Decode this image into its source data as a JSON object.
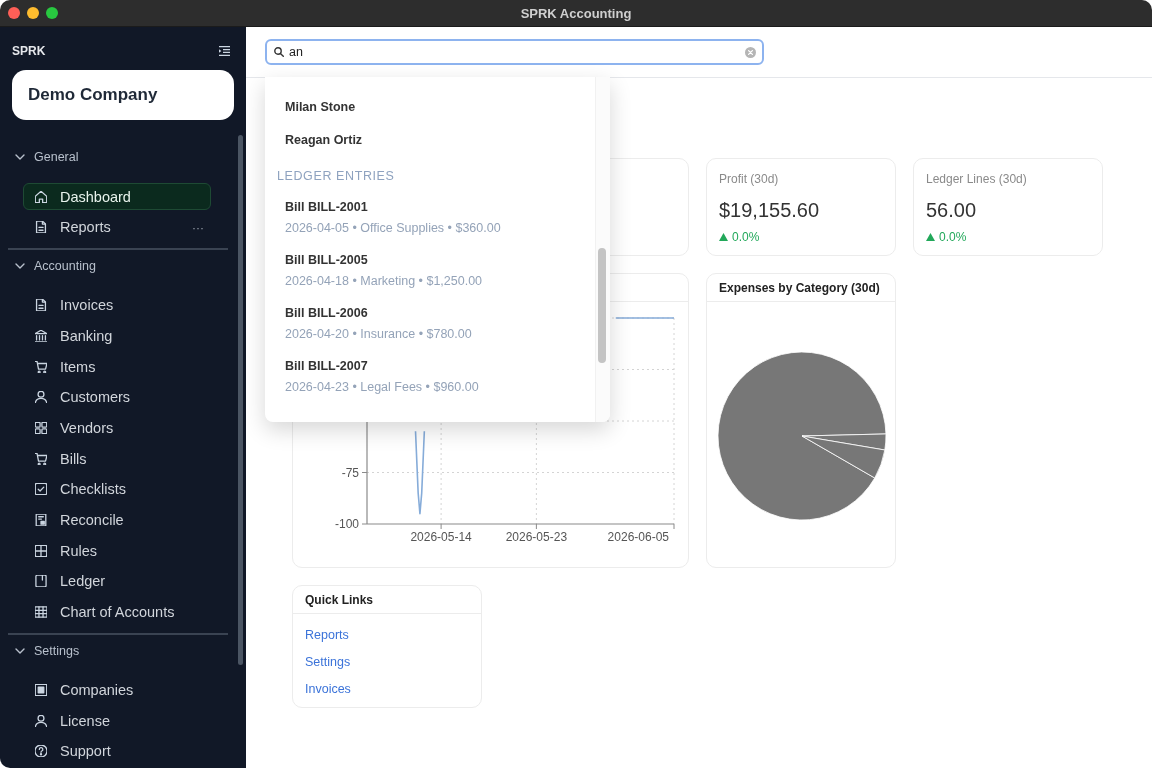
{
  "window": {
    "title": "SPRK Accounting"
  },
  "sidebar": {
    "brand": "SPRK",
    "company": "Demo Company",
    "groups": [
      {
        "title": "General",
        "expanded": true,
        "items": [
          {
            "label": "Dashboard",
            "selected": true
          },
          {
            "label": "Reports",
            "selected": false,
            "more": "···"
          }
        ]
      },
      {
        "title": "Accounting",
        "expanded": true,
        "items": [
          {
            "label": "Invoices",
            "selected": false
          },
          {
            "label": "Banking",
            "selected": false
          },
          {
            "label": "Items",
            "selected": false
          },
          {
            "label": "Customers",
            "selected": false
          },
          {
            "label": "Vendors",
            "selected": false
          },
          {
            "label": "Bills",
            "selected": false
          },
          {
            "label": "Checklists",
            "selected": false
          },
          {
            "label": "Reconcile",
            "selected": false
          },
          {
            "label": "Rules",
            "selected": false
          },
          {
            "label": "Ledger",
            "selected": false
          },
          {
            "label": "Chart of Accounts",
            "selected": false
          }
        ]
      },
      {
        "title": "Settings",
        "expanded": true,
        "items": [
          {
            "label": "Companies",
            "selected": false
          },
          {
            "label": "License",
            "selected": false
          },
          {
            "label": "Support",
            "selected": false
          }
        ]
      }
    ]
  },
  "search": {
    "value": "an",
    "results": [
      {
        "kind": "item",
        "title": "Milan Stone"
      },
      {
        "kind": "item",
        "title": "Reagan Ortiz"
      },
      {
        "kind": "heading",
        "title": "LEDGER ENTRIES"
      },
      {
        "kind": "entry",
        "title": "Bill BILL-2001",
        "detail": "2026-04-05 • Office Supplies • $360.00"
      },
      {
        "kind": "entry",
        "title": "Bill BILL-2005",
        "detail": "2026-04-18 • Marketing • $1,250.00"
      },
      {
        "kind": "entry",
        "title": "Bill BILL-2006",
        "detail": "2026-04-20 • Insurance • $780.00"
      },
      {
        "kind": "entry",
        "title": "Bill BILL-2007",
        "detail": "2026-04-23 • Legal Fees • $960.00"
      }
    ]
  },
  "stats": [
    {
      "label": "Profit (30d)",
      "value": "$19,155.60",
      "trend_up": true,
      "change": "0.0%"
    },
    {
      "label": "Ledger Lines (30d)",
      "value": "56.00",
      "trend_up": true,
      "change": "0.0%"
    }
  ],
  "line_chart": {
    "chart_data": {
      "type": "line",
      "x": [
        "2026-05-11T14:00",
        "2026-05-11T20:00",
        "2026-05-12",
        "2026-05-12T04:00",
        "2026-05-12T10:00",
        "2026-05-21",
        "2026-05-30T12:00",
        "2026-06-05"
      ],
      "series": [
        {
          "color": "#86acd9",
          "values": [
            -55,
            -85,
            -95,
            -85,
            -55,
            null,
            0,
            0
          ]
        }
      ],
      "xlim": [
        "2026-05-07",
        "2026-06-05"
      ],
      "ylim": [
        -100,
        0
      ],
      "xticks": [
        {
          "value": "2026-05-14",
          "label": "2026-05-14"
        },
        {
          "value": "2026-05-23",
          "label": "2026-05-23"
        },
        {
          "value": "2026-06-05",
          "label": "2026-06-05"
        }
      ],
      "yticks": [
        -100,
        -75
      ],
      "grid": true
    }
  },
  "expense_chart": {
    "title": "Expenses by Category (30d)"
  },
  "quick_links": {
    "title": "Quick Links",
    "links": [
      "Reports",
      "Settings",
      "Invoices"
    ]
  }
}
